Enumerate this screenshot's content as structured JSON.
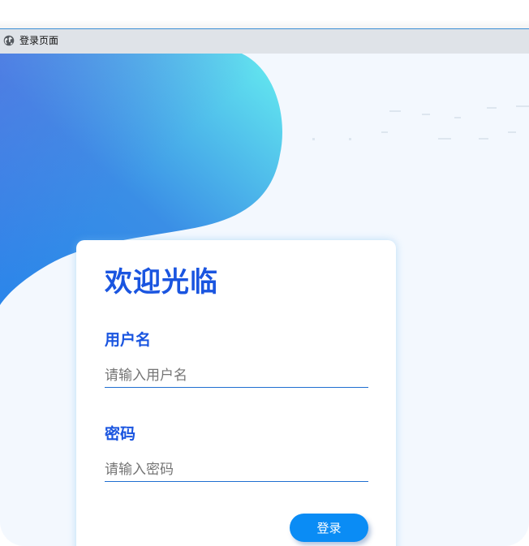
{
  "window": {
    "title": "登录页面",
    "icon": "globe-icon"
  },
  "login": {
    "heading": "欢迎光临",
    "username_label": "用户名",
    "username_placeholder": "请输入用户名",
    "username_value": "",
    "password_label": "密码",
    "password_placeholder": "请输入密码",
    "password_value": "",
    "submit_label": "登录"
  },
  "colors": {
    "accent": "#1a55e0",
    "button": "#0a8cf5",
    "background": "#f3f8fe",
    "blob_start": "#2f6fe0",
    "blob_end": "#5fe3ef"
  }
}
